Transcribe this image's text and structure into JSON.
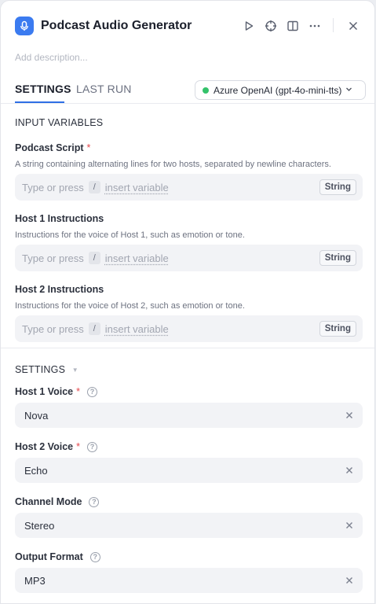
{
  "header": {
    "title": "Podcast Audio Generator",
    "description_placeholder": "Add description...",
    "icons": [
      "microphone-icon",
      "play-icon",
      "crosshair-icon",
      "split-view-icon",
      "more-icon",
      "close-icon"
    ]
  },
  "tabs": [
    {
      "label": "SETTINGS",
      "active": true
    },
    {
      "label": "LAST RUN",
      "active": false
    }
  ],
  "model": {
    "label": "Azure OpenAI (gpt-4o-mini-tts)",
    "status_color": "#34c26a"
  },
  "input_variables": {
    "section_title": "INPUT VARIABLES",
    "placeholder_prefix": "Type or press",
    "slash": "/",
    "insert_text": "insert variable",
    "fields": [
      {
        "label": "Podcast Script",
        "required": "*",
        "help": "A string containing alternating lines for two hosts, separated by newline characters.",
        "type": "String"
      },
      {
        "label": "Host 1 Instructions",
        "help": "Instructions for the voice of Host 1, such as emotion or tone.",
        "type": "String"
      },
      {
        "label": "Host 2 Instructions",
        "help": "Instructions for the voice of Host 2, such as emotion or tone.",
        "type": "String"
      }
    ]
  },
  "settings": {
    "section_title": "SETTINGS",
    "fields": [
      {
        "label": "Host 1 Voice",
        "required": "*",
        "value": "Nova"
      },
      {
        "label": "Host 2 Voice",
        "required": "*",
        "value": "Echo"
      },
      {
        "label": "Channel Mode",
        "value": "Stereo"
      },
      {
        "label": "Output Format",
        "value": "MP3"
      }
    ]
  },
  "colors": {
    "accent": "#2f6fe5",
    "required": "#e5484d",
    "app_icon": "#3b7bf0"
  }
}
